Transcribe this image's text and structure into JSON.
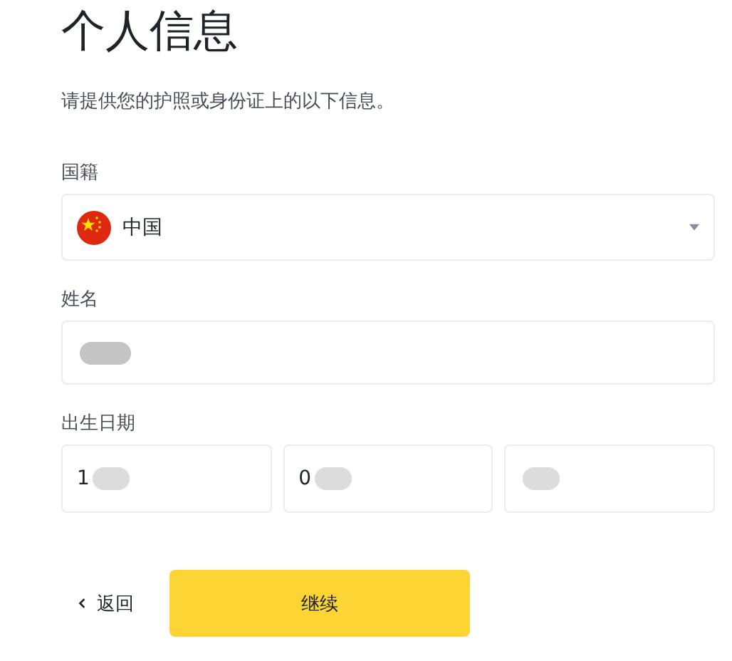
{
  "title": "个人信息",
  "subtitle": "请提供您的护照或身份证上的以下信息。",
  "nationality": {
    "label": "国籍",
    "value": "中国"
  },
  "name": {
    "label": "姓名",
    "redacted": true
  },
  "birth_date": {
    "label": "出生日期",
    "fields": [
      {
        "value": "1",
        "redacted": true
      },
      {
        "value": "0",
        "redacted": true
      },
      {
        "redacted": true
      }
    ]
  },
  "buttons": {
    "back": "返回",
    "continue": "继续"
  }
}
